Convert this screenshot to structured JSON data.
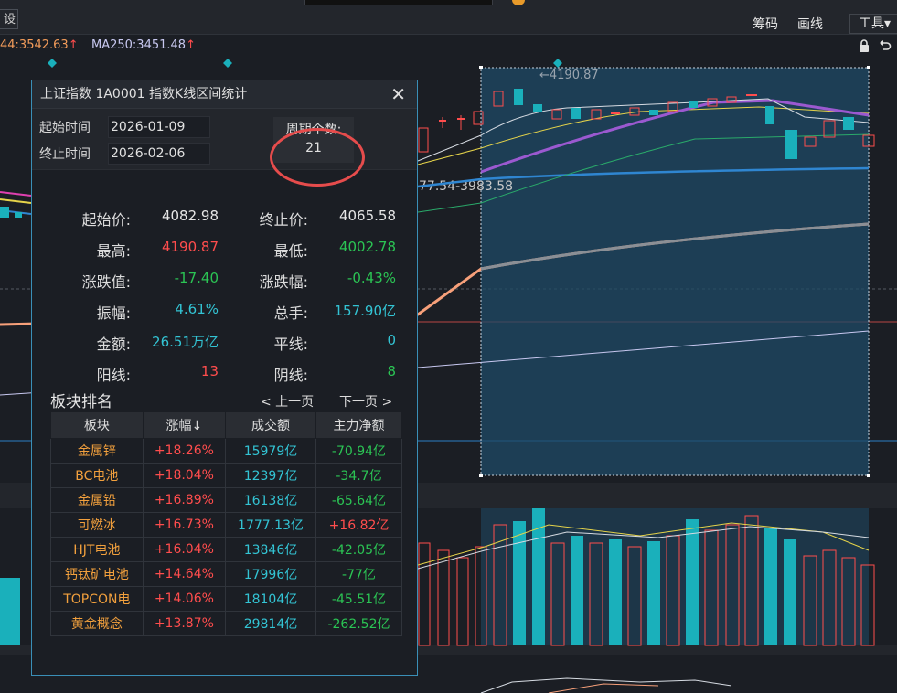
{
  "toolbar": {
    "left_label": "设",
    "chips_label": "筹码",
    "draw_label": "画线",
    "tools_label": "工具▾"
  },
  "ma_bar": {
    "ma_a": "44:3542.63",
    "ma_b": "MA250:3451.48",
    "arrow": "↑"
  },
  "chart_labels": {
    "high_marker": "←4190.87",
    "range_text": "77.54-3983.58"
  },
  "dialog": {
    "title": "上证指数  1A0001  指数K线区间统计",
    "start_label": "起始时间",
    "start_value": "2026-01-09",
    "end_label": "终止时间",
    "end_value": "2026-02-06",
    "period_label": "周期个数:",
    "period_value": "21",
    "stats": {
      "start_price_label": "起始价:",
      "start_price": "4082.98",
      "end_price_label": "终止价:",
      "end_price": "4065.58",
      "high_label": "最高:",
      "high": "4190.87",
      "low_label": "最低:",
      "low": "4002.78",
      "change_label": "涨跌值:",
      "change": "-17.40",
      "change_pct_label": "涨跌幅:",
      "change_pct": "-0.43%",
      "amp_label": "振幅:",
      "amp": "4.61%",
      "volume_label": "总手:",
      "volume": "157.90亿",
      "amount_label": "金额:",
      "amount": "26.51万亿",
      "flat_label": "平线:",
      "flat": "0",
      "yang_label": "阳线:",
      "yang": "13",
      "yin_label": "阴线:",
      "yin": "8"
    },
    "rank_title": "板块排名",
    "prev_page": "< 上一页",
    "next_page": "下一页 >",
    "columns": [
      "板块",
      "涨幅↓",
      "成交额",
      "主力净额"
    ],
    "rows": [
      {
        "name": "金属锌",
        "pct": "+18.26%",
        "amount": "15979亿",
        "net": "-70.94亿"
      },
      {
        "name": "BC电池",
        "pct": "+18.04%",
        "amount": "12397亿",
        "net": "-34.7亿"
      },
      {
        "name": "金属铅",
        "pct": "+16.89%",
        "amount": "16138亿",
        "net": "-65.64亿"
      },
      {
        "name": "可燃冰",
        "pct": "+16.73%",
        "amount": "1777.13亿",
        "net": "+16.82亿"
      },
      {
        "name": "HJT电池",
        "pct": "+16.04%",
        "amount": "13846亿",
        "net": "-42.05亿"
      },
      {
        "name": "钙钛矿电池",
        "pct": "+14.64%",
        "amount": "17996亿",
        "net": "-77亿"
      },
      {
        "name": "TOPCON电",
        "pct": "+14.06%",
        "amount": "18104亿",
        "net": "-45.51亿"
      },
      {
        "name": "黄金概念",
        "pct": "+13.87%",
        "amount": "29814亿",
        "net": "-262.52亿"
      }
    ]
  },
  "colors": {
    "up": "#ff4d4d",
    "down": "#2bc454",
    "cyan": "#1ab0bb",
    "selection": "#1f4a66",
    "accent": "#3a8fb7"
  }
}
